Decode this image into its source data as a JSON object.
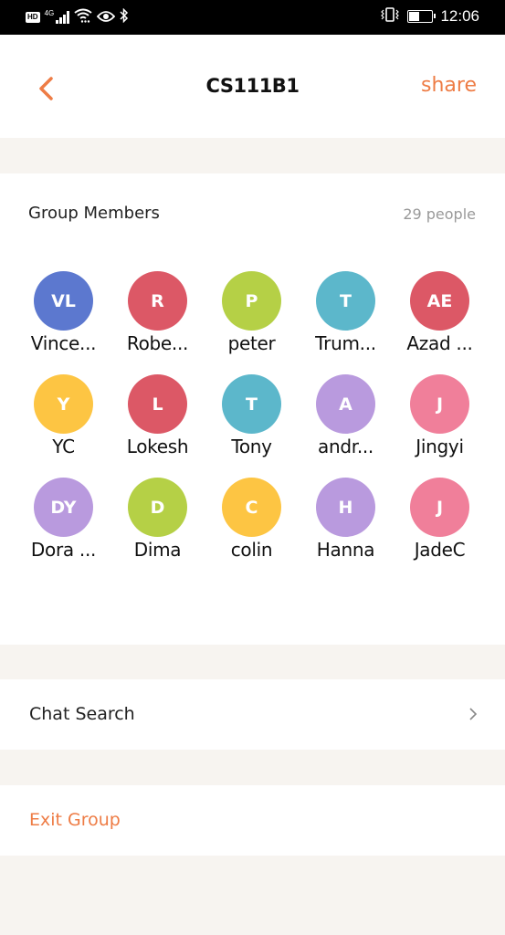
{
  "status_bar": {
    "left_icons": [
      "hd-icon",
      "4g-icon",
      "signal-icon",
      "wifi-icon",
      "eye-icon",
      "bluetooth-icon"
    ],
    "hd_label": "HD",
    "network_label": "4G",
    "right_icons": [
      "vibrate-icon",
      "battery-icon"
    ],
    "battery_level": 0.4,
    "time": "12:06"
  },
  "header": {
    "back_icon": "chevron-left-icon",
    "title": "CS111B1",
    "share_label": "share"
  },
  "members": {
    "heading": "Group Members",
    "count_label": "29 people",
    "items": [
      {
        "initials": "VL",
        "name": "Vince...",
        "color": "#5c78cf"
      },
      {
        "initials": "R",
        "name": "Robe...",
        "color": "#dc5866"
      },
      {
        "initials": "P",
        "name": "peter",
        "color": "#b5d046"
      },
      {
        "initials": "T",
        "name": "Trum...",
        "color": "#5cb7cb"
      },
      {
        "initials": "AE",
        "name": "Azad ...",
        "color": "#dc5866"
      },
      {
        "initials": "Y",
        "name": "YC",
        "color": "#fdc543"
      },
      {
        "initials": "L",
        "name": "Lokesh",
        "color": "#dc5866"
      },
      {
        "initials": "T",
        "name": "Tony",
        "color": "#5cb7cb"
      },
      {
        "initials": "A",
        "name": "andr...",
        "color": "#b99ade"
      },
      {
        "initials": "J",
        "name": "Jingyi",
        "color": "#f07f9a"
      },
      {
        "initials": "DY",
        "name": "Dora ...",
        "color": "#b99ade"
      },
      {
        "initials": "D",
        "name": "Dima",
        "color": "#b5d046"
      },
      {
        "initials": "C",
        "name": "colin",
        "color": "#fdc543"
      },
      {
        "initials": "H",
        "name": "Hanna",
        "color": "#b99ade"
      },
      {
        "initials": "J",
        "name": "JadeC",
        "color": "#f07f9a"
      }
    ]
  },
  "chat_search": {
    "label": "Chat Search",
    "icon": "chevron-right-icon"
  },
  "exit_group": {
    "label": "Exit Group"
  },
  "colors": {
    "accent": "#ee7c45",
    "background": "#f7f4f0",
    "card": "#ffffff"
  }
}
